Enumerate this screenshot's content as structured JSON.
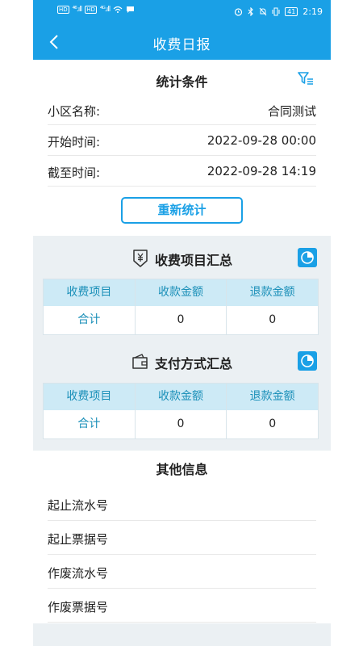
{
  "status_bar": {
    "sim1": "HD",
    "sim2": "HD",
    "signal1": "⁴⁶.ıll",
    "signal2": "⁴ᴳ.ıll",
    "battery": "41",
    "time": "2:19"
  },
  "nav": {
    "title": "收费日报"
  },
  "conditions": {
    "title": "统计条件",
    "rows": [
      {
        "label": "小区名称:",
        "value": "合同测试"
      },
      {
        "label": "开始时间:",
        "value": "2022-09-28 00:00"
      },
      {
        "label": "截至时间:",
        "value": "2022-09-28 14:19"
      }
    ],
    "recount_label": "重新统计"
  },
  "fee_summary": {
    "title": "收费项目汇总",
    "headers": [
      "收费项目",
      "收款金额",
      "退款金额"
    ],
    "rows": [
      {
        "item": "合计",
        "received": "0",
        "refunded": "0"
      }
    ]
  },
  "payment_summary": {
    "title": "支付方式汇总",
    "headers": [
      "收费项目",
      "收款金额",
      "退款金额"
    ],
    "rows": [
      {
        "item": "合计",
        "received": "0",
        "refunded": "0"
      }
    ]
  },
  "other_info": {
    "title": "其他信息",
    "items": [
      "起止流水号",
      "起止票据号",
      "作废流水号",
      "作废票据号"
    ]
  },
  "colors": {
    "primary": "#1aa0e6",
    "table_header_bg": "#cdeaf6",
    "table_header_text": "#1a8fb8",
    "section_bg": "#ebf0f3"
  }
}
